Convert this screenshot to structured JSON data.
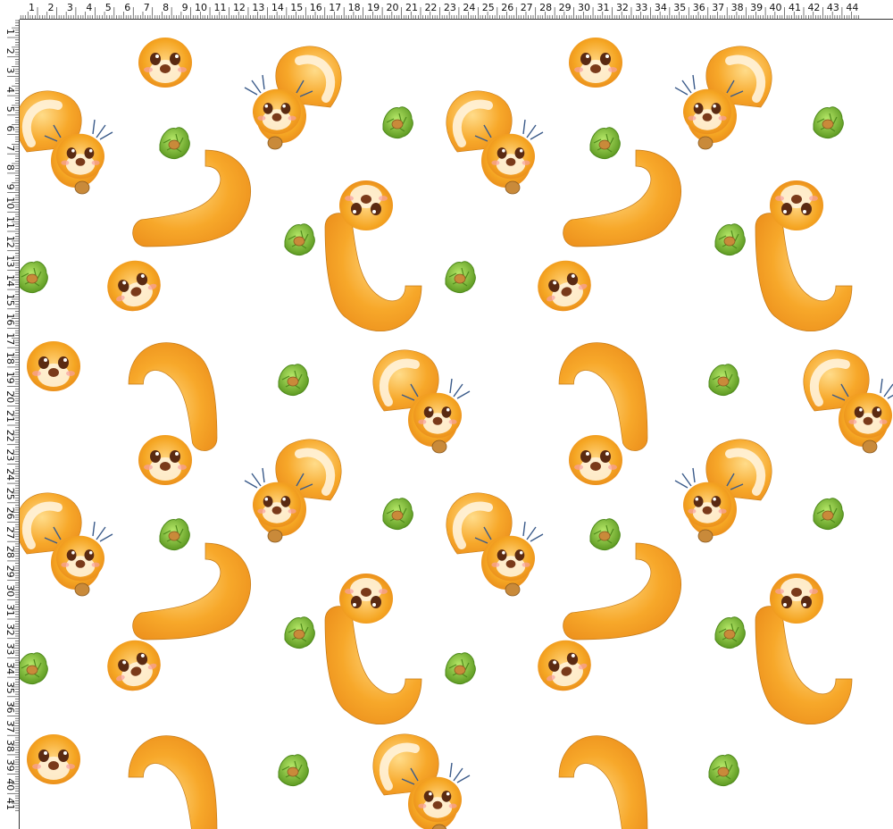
{
  "ruler": {
    "top_labels": [
      "1",
      "2",
      "3",
      "4",
      "5",
      "6",
      "7",
      "8",
      "9",
      "10",
      "11",
      "12",
      "13",
      "14",
      "15",
      "16",
      "17",
      "18",
      "19",
      "20",
      "21",
      "22",
      "23",
      "24",
      "25",
      "26",
      "27",
      "28",
      "29",
      "30",
      "31",
      "32",
      "33",
      "34",
      "35",
      "36",
      "37",
      "38",
      "39",
      "40",
      "41",
      "42",
      "43",
      "44"
    ],
    "left_labels": [
      "1",
      "2",
      "3",
      "4",
      "5",
      "6",
      "7",
      "8",
      "9",
      "10",
      "11",
      "12",
      "13",
      "14",
      "15",
      "16",
      "17",
      "18",
      "19",
      "20",
      "21",
      "22",
      "23",
      "24",
      "25",
      "26",
      "27",
      "28",
      "29",
      "30",
      "31",
      "32",
      "33",
      "34",
      "35",
      "36",
      "37",
      "38",
      "39",
      "40",
      "41"
    ]
  },
  "pattern": {
    "colors": {
      "fur": "#f5a623",
      "fur_light": "#ffd27a",
      "fur_dark": "#e8891a",
      "belly": "#fff6e6",
      "eye": "#5a2a12",
      "nose": "#7a3a1a",
      "ear_tuft": "#3b5b8a",
      "nut_husk": "#8fcf3a",
      "nut_husk_dark": "#5e9a22",
      "nut_shell": "#c98a3a"
    },
    "motifs": [
      "squirrel",
      "hazelnut"
    ]
  }
}
